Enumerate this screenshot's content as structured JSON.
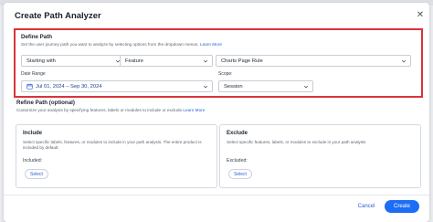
{
  "dialog": {
    "title": "Create Path Analyzer",
    "close_icon": "close-icon"
  },
  "define_path": {
    "title": "Define Path",
    "description": "Set the user journey path you want to analyze by selecting options from the dropdown menus.",
    "learn_more": "Learn More",
    "start_select": {
      "value": "Starting with"
    },
    "type_select": {
      "value": "Feature"
    },
    "item_select": {
      "value": "Charts Page Rule"
    },
    "date_range": {
      "label": "Date Range",
      "value": "Jul 01, 2024 – Sep 30, 2024",
      "icon": "calendar-icon"
    },
    "scope": {
      "label": "Scope:",
      "value": "Session"
    }
  },
  "refine_path": {
    "title": "Refine Path (optional)",
    "description": "Customize your analysis by specifying features, labels or modules to include or exclude.",
    "learn_more": "Learn More",
    "include": {
      "title": "Include",
      "description": "Select specific labels, features, or modules to include in your path analysis. The entire product is included by default.",
      "sub_label": "Included:",
      "button": "Select"
    },
    "exclude": {
      "title": "Exclude",
      "description": "Select specific features, labels, or modules to exclude in your path analysis",
      "sub_label": "Excluded:",
      "button": "Select"
    }
  },
  "footer": {
    "cancel": "Cancel",
    "create": "Create"
  },
  "colors": {
    "accent": "#1d6ef5",
    "highlight_border": "#d9343a",
    "link": "#2b62d6"
  }
}
